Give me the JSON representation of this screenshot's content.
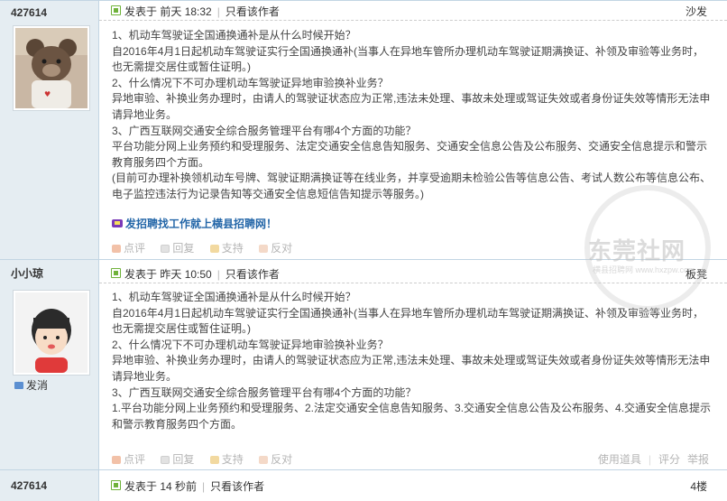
{
  "posts": [
    {
      "author": "427614",
      "meta": {
        "posted_label": "发表于",
        "time": "前天 18:32",
        "only_author": "只看该作者",
        "floor": "沙发"
      },
      "lines": [
        "1、机动车驾驶证全国通换通补是从什么时候开始？",
        "自2016年4月1日起机动车驾驶证实行全国通换通补(当事人在异地车管所办理机动车驾驶证期满换证、补领及审验等业务时，也无需提交居住或暂住证明。)",
        "2、什么情况下不可办理机动车驾驶证异地审验换补业务？",
        "异地审验、补换业务办理时，由请人的驾驶证状态应为正常,违法未处理、事故未处理或驾证失效或者身份证失效等情形无法申请异地业务。",
        "3、广西互联网交通安全综合服务管理平台有哪4个方面的功能？",
        "平台功能分网上业务预约和受理服务、法定交通安全信息告知服务、交通安全信息公告及公布服务、交通安全信息提示和警示教育服务四个方面。",
        "(目前可办理补换领机动车号牌、驾驶证期满换证等在线业务，并享受逾期未检验公告等信息公告、考试人数公布等信息公布、电子监控违法行为记录告知等交通安全信息短信告知提示等服务。)"
      ],
      "promo": "发招聘找工作就上横县招聘网！",
      "actions": {
        "like": "点评",
        "reply": "回复",
        "support": "支持",
        "oppose": "反对"
      }
    },
    {
      "author": "小小琼",
      "report": "发消",
      "meta": {
        "posted_label": "发表于",
        "time": "昨天 10:50",
        "only_author": "只看该作者",
        "floor": "板凳"
      },
      "lines": [
        "1、机动车驾驶证全国通换通补是从什么时候开始？",
        "自2016年4月1日起机动车驾驶证实行全国通换通补(当事人在异地车管所办理机动车驾驶证期满换证、补领及审验等业务时，也无需提交居住或暂住证明。)",
        "2、什么情况下不可办理机动车驾驶证异地审验换补业务？",
        "异地审验、补换业务办理时，由请人的驾驶证状态应为正常,违法未处理、事故未处理或驾证失效或者身份证失效等情形无法申请异地业务。",
        "3、广西互联网交通安全综合服务管理平台有哪4个方面的功能？",
        "1.平台功能分网上业务预约和受理服务、2.法定交通安全信息告知服务、3.交通安全信息公告及公布服务、4.交通安全信息提示和警示教育服务四个方面。"
      ],
      "actions": {
        "like": "点评",
        "reply": "回复",
        "support": "支持",
        "oppose": "反对"
      },
      "right_actions": {
        "tools": "使用道具",
        "rate": "评分",
        "report": "举报"
      }
    },
    {
      "author": "427614",
      "meta": {
        "posted_label": "发表于",
        "time": "14 秒前",
        "only_author": "只看该作者",
        "floor": "4楼"
      }
    }
  ],
  "watermark": {
    "text": "东莞社网",
    "sub": "横县招聘网 www.hxzpw.com"
  },
  "colors": {
    "sidebar_bg": "#e5edf2",
    "border": "#c2d5e3",
    "promo": "#2366a8"
  }
}
